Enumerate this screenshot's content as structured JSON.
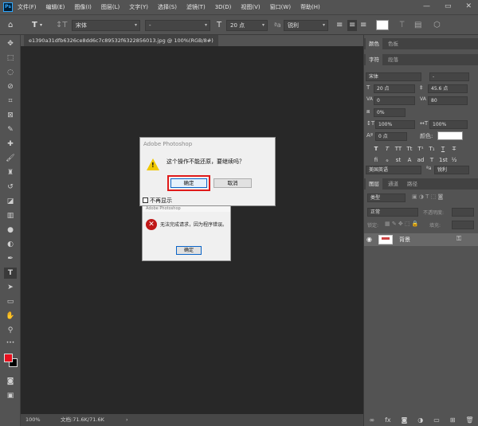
{
  "app": {
    "logo": "Ps"
  },
  "menu": [
    "文件(F)",
    "编辑(E)",
    "图像(I)",
    "图层(L)",
    "文字(Y)",
    "选择(S)",
    "滤镜(T)",
    "3D(D)",
    "视图(V)",
    "窗口(W)",
    "帮助(H)"
  ],
  "window_controls": [
    "—",
    "▭",
    "✕"
  ],
  "options": {
    "font_family": "宋体",
    "font_style": "-",
    "font_size": "20 点",
    "antialias": "锐利",
    "text_tool_glyph": "T",
    "size_glyph": "T"
  },
  "document": {
    "tab_label": "e1390a31dfb6326ce8dd6c7c89532f6322856013.jpg @ 100%(RGB/8#)",
    "zoom": "100%",
    "doc_info": "文档:71.6K/71.6K"
  },
  "dialog_back": {
    "title": "Adobe Photoshop",
    "message": "无法完成请求，因为程序错误。",
    "ok_label": "确定",
    "icon": "error-icon"
  },
  "dialog_front": {
    "title": "Adobe Photoshop",
    "message": "这个操作不能还原，要继续吗？",
    "ok_label": "确定",
    "cancel_label": "取消",
    "checkbox_label": "不再显示",
    "icon": "warning-icon",
    "highlight_color": "#e01a1a"
  },
  "panels": {
    "color_tabs": [
      "颜色",
      "色板"
    ],
    "char_tabs": [
      "字符",
      "段落"
    ],
    "character": {
      "font_family": "宋体",
      "font_style": "-",
      "size": "20 点",
      "leading": "45.6 点",
      "kerning": "0",
      "tracking": "80",
      "scale_percent": "0%",
      "vertical_scale": "100%",
      "horizontal_scale": "100%",
      "baseline_shift": "0 点",
      "color_label": "颜色:",
      "language": "美国英语",
      "antialias": "锐利",
      "style_buttons": [
        "T",
        "T",
        "TT",
        "Tt",
        "T¹",
        "T₁",
        "T",
        "T̶"
      ],
      "extra_buttons": [
        "fi",
        "ℴ",
        "st",
        "A",
        "ad",
        "T",
        "1st",
        "½"
      ]
    },
    "layer_tabs": [
      "图层",
      "通道",
      "路径"
    ],
    "layers": {
      "filter": "类型",
      "blend_mode": "正常",
      "opacity_label": "不透明度:",
      "lock_label": "锁定:",
      "fill_label": "填充:",
      "layer_name": "背景"
    }
  },
  "colors": {
    "foreground": "#e8101e",
    "background": "#000000",
    "accent": "#31a8ff"
  }
}
